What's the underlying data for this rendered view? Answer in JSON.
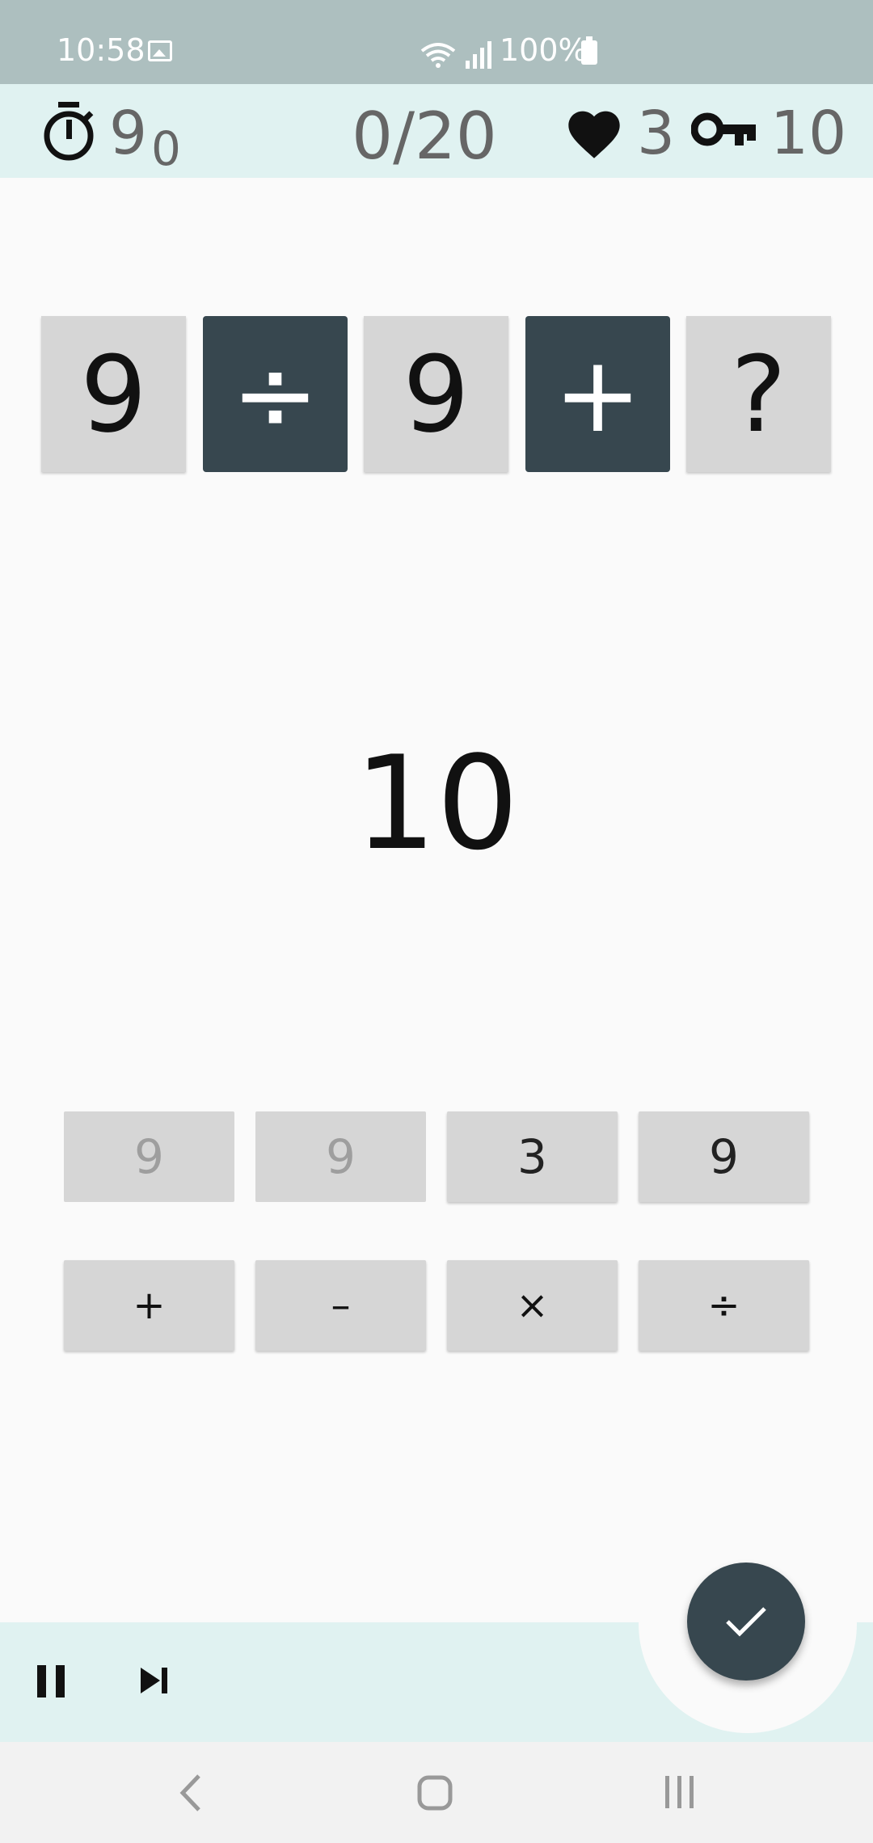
{
  "status_bar": {
    "time": "10:58",
    "battery_percent": "100%"
  },
  "top_bar": {
    "timer_main": "9",
    "timer_sub": "0",
    "progress": "0/20",
    "lives": "3",
    "keys": "10"
  },
  "equation": {
    "tiles": [
      "9",
      "÷",
      "9",
      "+",
      "?"
    ]
  },
  "target": "10",
  "number_keys": [
    {
      "label": "9",
      "used": true
    },
    {
      "label": "9",
      "used": true
    },
    {
      "label": "3",
      "used": false
    },
    {
      "label": "9",
      "used": false
    }
  ],
  "operator_keys": [
    "+",
    "–",
    "×",
    "÷"
  ],
  "colors": {
    "status_bar": "#adbfbf",
    "top_bar": "#e0f2f1",
    "operator_tile": "#37474f",
    "number_tile": "#d6d6d6",
    "fab": "#37474f"
  }
}
